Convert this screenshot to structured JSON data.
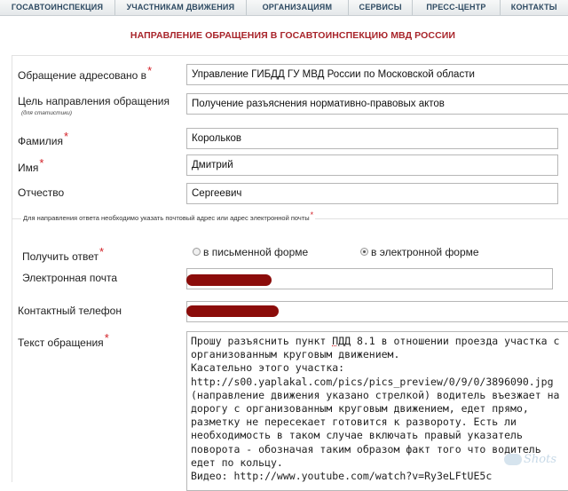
{
  "nav": {
    "items": [
      "ГОСАВТОИНСПЕКЦИЯ",
      "УЧАСТНИКАМ ДВИЖЕНИЯ",
      "ОРГАНИЗАЦИЯМ",
      "СЕРВИСЫ",
      "ПРЕСС-ЦЕНТР",
      "КОНТАКТЫ"
    ]
  },
  "page_title": "НАПРАВЛЕНИЕ ОБРАЩЕНИЯ В ГОСАВТОИНСПЕКЦИЮ МВД РОССИИ",
  "required_mark": "*",
  "form": {
    "addressee": {
      "label": "Обращение адресовано в",
      "value": "Управление ГИБДД ГУ МВД России по Московской области"
    },
    "purpose": {
      "label": "Цель направления обращения",
      "sub": "(для статистики)",
      "value": "Получение разъяснения нормативно-правовых актов"
    },
    "surname": {
      "label": "Фамилия",
      "value": "Корольков"
    },
    "name": {
      "label": "Имя",
      "value": "Дмитрий"
    },
    "patronymic": {
      "label": "Отчество",
      "value": "Сергеевич"
    },
    "reply_group": {
      "legend": "Для направления ответа необходимо указать почтовый адрес или адрес электронной почты",
      "receive_label": "Получить ответ",
      "option_paper": "в письменной форме",
      "option_email": "в электронной форме",
      "selected": "option_email",
      "email_label": "Электронная почта"
    },
    "phone": {
      "label": "Контактный телефон"
    },
    "message": {
      "label": "Текст обращения",
      "line1_before": "Прошу разъяснить пункт ",
      "line1_pdd": "ПДД",
      "line1_after": " 8.1 в отношении проезда участка с",
      "rest": "организованным круговым движением.\nКасательно этого участка:\nhttp://s00.yaplakal.com/pics/pics_preview/0/9/0/3896090.jpg\n(направление движения указано стрелкой) водитель въезжает на\nдорогу с организованным круговым движением, едет прямо,\nразметку не пересекает готовится к развороту. Есть ли\nнеобходимость в таком случае включать правый указатель\nповорота - обозначая таким образом факт того что водитель\nедет по кольцу.\nВидео: http://www.youtube.com/watch?v=Ry3eLFtUE5c"
    }
  },
  "watermark": "Shots",
  "colors": {
    "title_red": "#a8242a",
    "required_red": "#d21f26",
    "redaction": "#8b0c0a",
    "nav_text": "#2e4a62"
  }
}
